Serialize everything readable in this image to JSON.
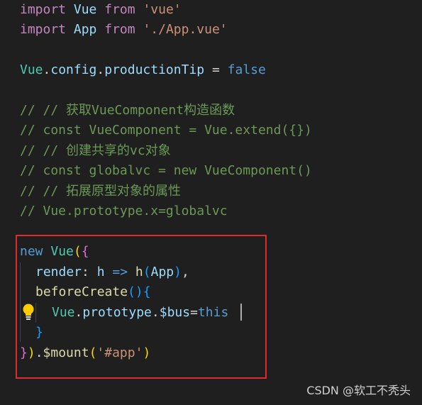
{
  "code": {
    "line1": {
      "kw": "import",
      "name": "Vue",
      "from": "from",
      "path": "'vue'"
    },
    "line2": {
      "kw": "import",
      "name": "App",
      "from": "from",
      "path": "'./App.vue'"
    },
    "line4": {
      "obj": "Vue",
      "dot1": ".",
      "config": "config",
      "dot2": ".",
      "prop": "productionTip",
      "eq": " = ",
      "value": "false"
    },
    "comments": [
      "// // 获取VueComponent构造函数",
      "// const VueComponent = Vue.extend({})",
      "// // 创建共享的vc对象",
      "// const globalvc = new VueComponent()",
      "// // 拓展原型对象的属性",
      "// Vue.prototype.x=globalvc"
    ],
    "block": {
      "new_kw": "new",
      "vue": "Vue",
      "open_paren": "(",
      "open_brace": "{",
      "render_key": "render",
      "colon": ": ",
      "h_param": "h",
      "arrow": " => ",
      "h_call": "h",
      "app_paren_open": "(",
      "app_arg": "App",
      "app_paren_close": ")",
      "comma": ",",
      "before_create": "beforeCreate",
      "bc_parens": "()",
      "bc_brace_open": "{",
      "proto_obj": "Vue",
      "proto_dot1": ".",
      "proto_prop": "prototype",
      "proto_dot2": ".",
      "bus_prop": "$bus",
      "assign": "=",
      "this_kw": "this",
      "bc_brace_close": "}",
      "close_brace": "}",
      "close_paren": ")",
      "mount_dot": ".",
      "mount_fn": "$mount",
      "mount_open": "(",
      "mount_arg": "'#app'",
      "mount_close": ")"
    }
  },
  "watermark": "CSDN @软工不秃头",
  "colors": {
    "background": "#1f1f1f",
    "keyword": "#c586c0",
    "control": "#569cd6",
    "class": "#4ec9b0",
    "variable": "#9cdcfe",
    "function": "#dcdcaa",
    "string": "#ce9178",
    "comment": "#6a9955",
    "highlight_border": "#e02b2b"
  },
  "icons": {
    "lightbulb": "lightbulb-icon"
  }
}
